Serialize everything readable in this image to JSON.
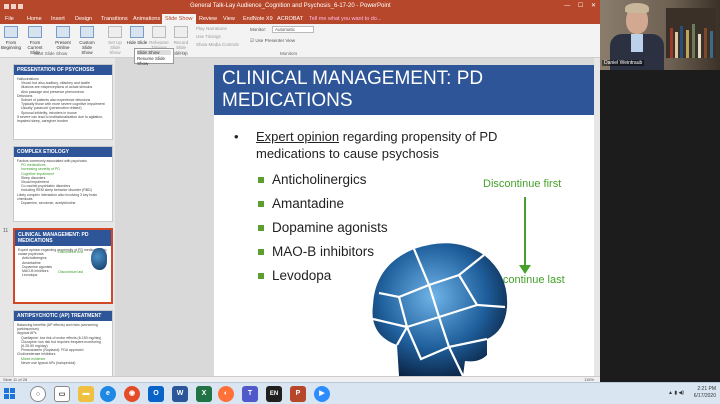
{
  "title_bar": {
    "document_title": "General Talk-Lay Audience_Cognition and Psychosis_6-17-20 - PowerPoint",
    "window_controls": [
      "—",
      "☐",
      "✕"
    ]
  },
  "ribbon_tabs": [
    {
      "label": "File"
    },
    {
      "label": "Home"
    },
    {
      "label": "Insert"
    },
    {
      "label": "Design"
    },
    {
      "label": "Transitions"
    },
    {
      "label": "Animations"
    },
    {
      "label": "Slide Show",
      "active": true
    },
    {
      "label": "Review"
    },
    {
      "label": "View"
    },
    {
      "label": "EndNote X9"
    },
    {
      "label": "ACROBAT"
    },
    {
      "label": "Tell me what you want to do..."
    }
  ],
  "ribbon": {
    "buttons": [
      {
        "label": "From Beginning",
        "enabled": true
      },
      {
        "label": "From Current Slide",
        "enabled": true
      },
      {
        "label": "Present Online",
        "enabled": true
      },
      {
        "label": "Custom Slide Show",
        "enabled": true
      },
      {
        "label": "Set Up Slide Show",
        "enabled": false
      },
      {
        "label": "Hide Slide",
        "enabled": true
      },
      {
        "label": "Rehearse Timings",
        "enabled": false
      },
      {
        "label": "Record Slide Show",
        "enabled": false
      }
    ],
    "checkbox_options": [
      "Play Narrations",
      "Use Timings",
      "Show Media Controls"
    ],
    "monitor_label": "Monitor:",
    "monitor_value": "Automatic",
    "presenter_view_label": "Use Presenter View",
    "group_labels": [
      "Start Slide Show",
      "Set Up",
      "Monitors"
    ],
    "tooltip_title": "Slide Show",
    "tooltip_text": "Resume Slide Show"
  },
  "thumbnails": [
    {
      "number": "",
      "title": "PRESENTATION OF PSYCHOSIS",
      "lines": [
        "Hallucinations",
        "Visual: but also auditory, olfactory and tactile",
        "Illusions are misperceptions of actual stimulus",
        "Also passage and presence phenomena",
        "Delusions",
        "Subset of patients also experience delusions",
        "Typically those with more severe cognitive impairment",
        "Usually 'paranoid' (persecution related)",
        "Spousal infidelity, intruders in house",
        "If severe can lead to institutionalization due to agitation, impaired sleep, caregiver burden"
      ],
      "selected": false
    },
    {
      "number": "",
      "title": "COMPLEX ETIOLOGY",
      "lines": [
        "Factors commonly associated with psychosis",
        "PD medications",
        "Increasing severity of PD",
        "Cognitive impairment",
        "Sleep disorders",
        "Visual impairment",
        "Co-morbid psychiatric disorders",
        "Including REM sleep behavior disorder (RBD)",
        "Likely complex interaction also involving 3 key brain chemicals",
        "Dopamine, serotonin, acetylcholine"
      ],
      "selected": false
    },
    {
      "number": "11",
      "title": "CLINICAL MANAGEMENT: PD MEDICATIONS",
      "lines": [
        "Expert opinion regarding propensity of PD medications to cause psychosis",
        "Anticholinergics",
        "Amantadine",
        "Dopamine agonists",
        "MAO-B inhibitors",
        "Levodopa"
      ],
      "mini_labels": [
        "Discontinue first",
        "Discontinue last"
      ],
      "selected": true
    },
    {
      "number": "",
      "title": "ANTIPSYCHOTIC (AP) TREATMENT",
      "lines": [
        "Balancing benefits (AP effects) and risks (worsening parkinsonism)",
        "Atypical APs",
        "Quetiapine: low risk of motor effects (6-150 mg/day)",
        "Clozapine: low risk but requires frequent monitoring (6.25-50 mg/day)",
        "Pimavanserin (Nuplazid): FDA approved",
        "Cholinesterase inhibitors",
        "Mixed evidence",
        "Never use typical APs (haloperidol)"
      ],
      "selected": false
    }
  ],
  "slide": {
    "title": "CLINICAL MANAGEMENT: PD MEDICATIONS",
    "bullet_lead": "Expert opinion",
    "bullet_rest": " regarding propensity of PD medications to cause psychosis",
    "items": [
      "Anticholinergics",
      "Amantadine",
      "Dopamine agonists",
      "MAO-B inhibitors",
      "Levodopa"
    ],
    "discontinue_first": "Discontinue first",
    "discontinue_last": "Discontinue last"
  },
  "status_bar": {
    "slide_indicator": "Slide 11 of 28",
    "zoom": "115%"
  },
  "video": {
    "participant_name": "Daniel Weintraub"
  },
  "taskbar": {
    "time": "2:21 PM",
    "date": "6/17/2020",
    "icons": [
      "windows-start",
      "search",
      "task-view",
      "file-explorer",
      "edge",
      "chrome",
      "outlook",
      "word",
      "excel",
      "firefox",
      "teams",
      "endnote",
      "powerpoint",
      "zoom"
    ]
  },
  "colors": {
    "accent": "#b7472a",
    "slide_title_bg": "#2e5597",
    "green": "#46a02b"
  }
}
